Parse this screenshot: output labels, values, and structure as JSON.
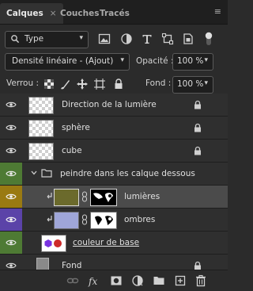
{
  "tabs": [
    {
      "label": "Calques",
      "close": "×"
    },
    {
      "label": "Couches"
    },
    {
      "label": "Tracés"
    }
  ],
  "panel_menu": "≡",
  "filter": {
    "kind_label": "Type"
  },
  "blend": {
    "mode": "Densité linéaire - (Ajout)",
    "opacity_label": "Opacité :",
    "opacity_value": "100 %"
  },
  "locks": {
    "label": "Verrou :",
    "fill_label": "Fond :",
    "fill_value": "100 %"
  },
  "layers": [
    {
      "name": "Direction  de la lumière",
      "vis_color": "#2f2f2f",
      "locked": true
    },
    {
      "name": "sphère",
      "vis_color": "#2f2f2f",
      "locked": true
    },
    {
      "name": "cube",
      "vis_color": "#2f2f2f",
      "locked": true
    },
    {
      "name": "peindre dans les calque dessous",
      "vis_color": "#4e7a34",
      "group": true
    },
    {
      "name": "lumières",
      "vis_color": "#9a7a12",
      "selected": true,
      "clip": true,
      "thumb_color": "#6b6a2c"
    },
    {
      "name": "ombres",
      "vis_color": "#5b43a8",
      "clip": true,
      "thumb_color": "#9fa6d8"
    },
    {
      "name": "couleur de base",
      "vis_color": "#4e7a34"
    },
    {
      "name": "Fond",
      "vis_color": "#2f2f2f",
      "locked": true,
      "thumb_color": "#8a8a8a"
    }
  ],
  "colors": {
    "group_green": "#4e7a34",
    "orange": "#9a7a12",
    "violet": "#5b43a8"
  }
}
